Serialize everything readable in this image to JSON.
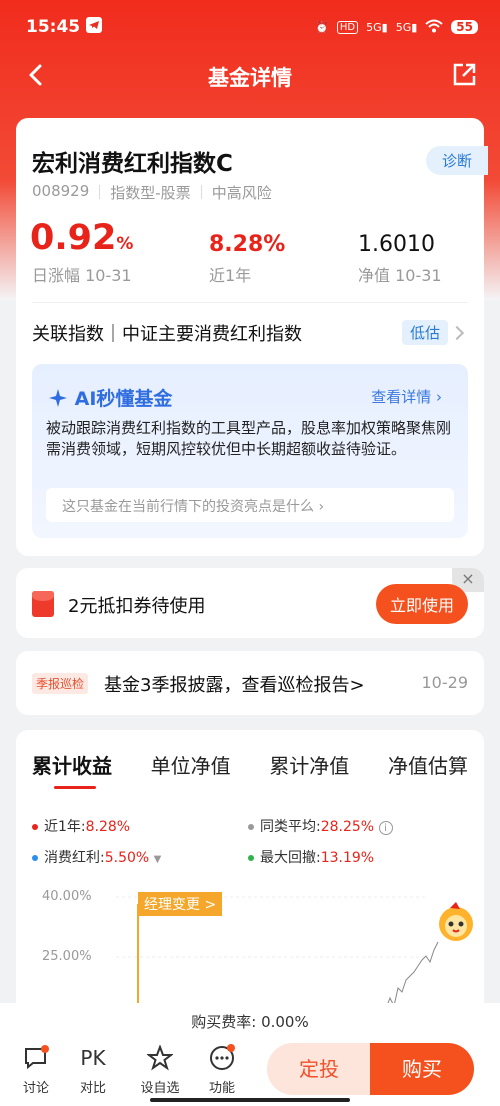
{
  "status": {
    "time": "15:45",
    "battery": "55"
  },
  "nav": {
    "title": "基金详情"
  },
  "fund": {
    "name": "宏利消费红利指数C",
    "diagnose": "诊断",
    "code": "008929",
    "type": "指数型-股票",
    "risk": "中高风险",
    "daily_change": "0.92",
    "daily_change_unit": "%",
    "daily_label": "日涨幅 10-31",
    "year_return": "8.28%",
    "year_label": "近1年",
    "nav_value": "1.6010",
    "nav_label": "净值 10-31"
  },
  "related": {
    "text": "关联指数｜中证主要消费红利指数",
    "badge": "低估"
  },
  "ai": {
    "title": "AI秒懂基金",
    "more": "查看详情",
    "desc": "被动跟踪消费红利指数的工具型产品，股息率加权策略聚焦刚需消费领域，短期风控较优但中长期超额收益待验证。",
    "question": "这只基金在当前行情下的投资亮点是什么"
  },
  "coupon": {
    "text": "2元抵扣券待使用",
    "button": "立即使用"
  },
  "report": {
    "badge": "季报巡检",
    "text": "基金3季报披露，查看巡检报告>",
    "date": "10-29"
  },
  "chart": {
    "tabs": [
      "累计收益",
      "单位净值",
      "累计净值",
      "净值估算"
    ],
    "legend": [
      {
        "label": "近1年:",
        "value": "8.28%",
        "color": "#e8231a"
      },
      {
        "label": "同类平均:",
        "value": "28.25%",
        "color": "#999999"
      },
      {
        "label": "消费红利:",
        "value": "5.50%",
        "color": "#2a8ef0"
      },
      {
        "label": "最大回撤:",
        "value": "13.19%",
        "color": "#2cb34a"
      }
    ],
    "yticks": [
      "40.00%",
      "25.00%"
    ],
    "event": "经理变更 >"
  },
  "bottom": {
    "fee": "购买费率: 0.00%",
    "items": [
      "讨论",
      "对比",
      "设自选",
      "功能"
    ],
    "pk": "PK",
    "fix": "定投",
    "buy": "购买"
  }
}
